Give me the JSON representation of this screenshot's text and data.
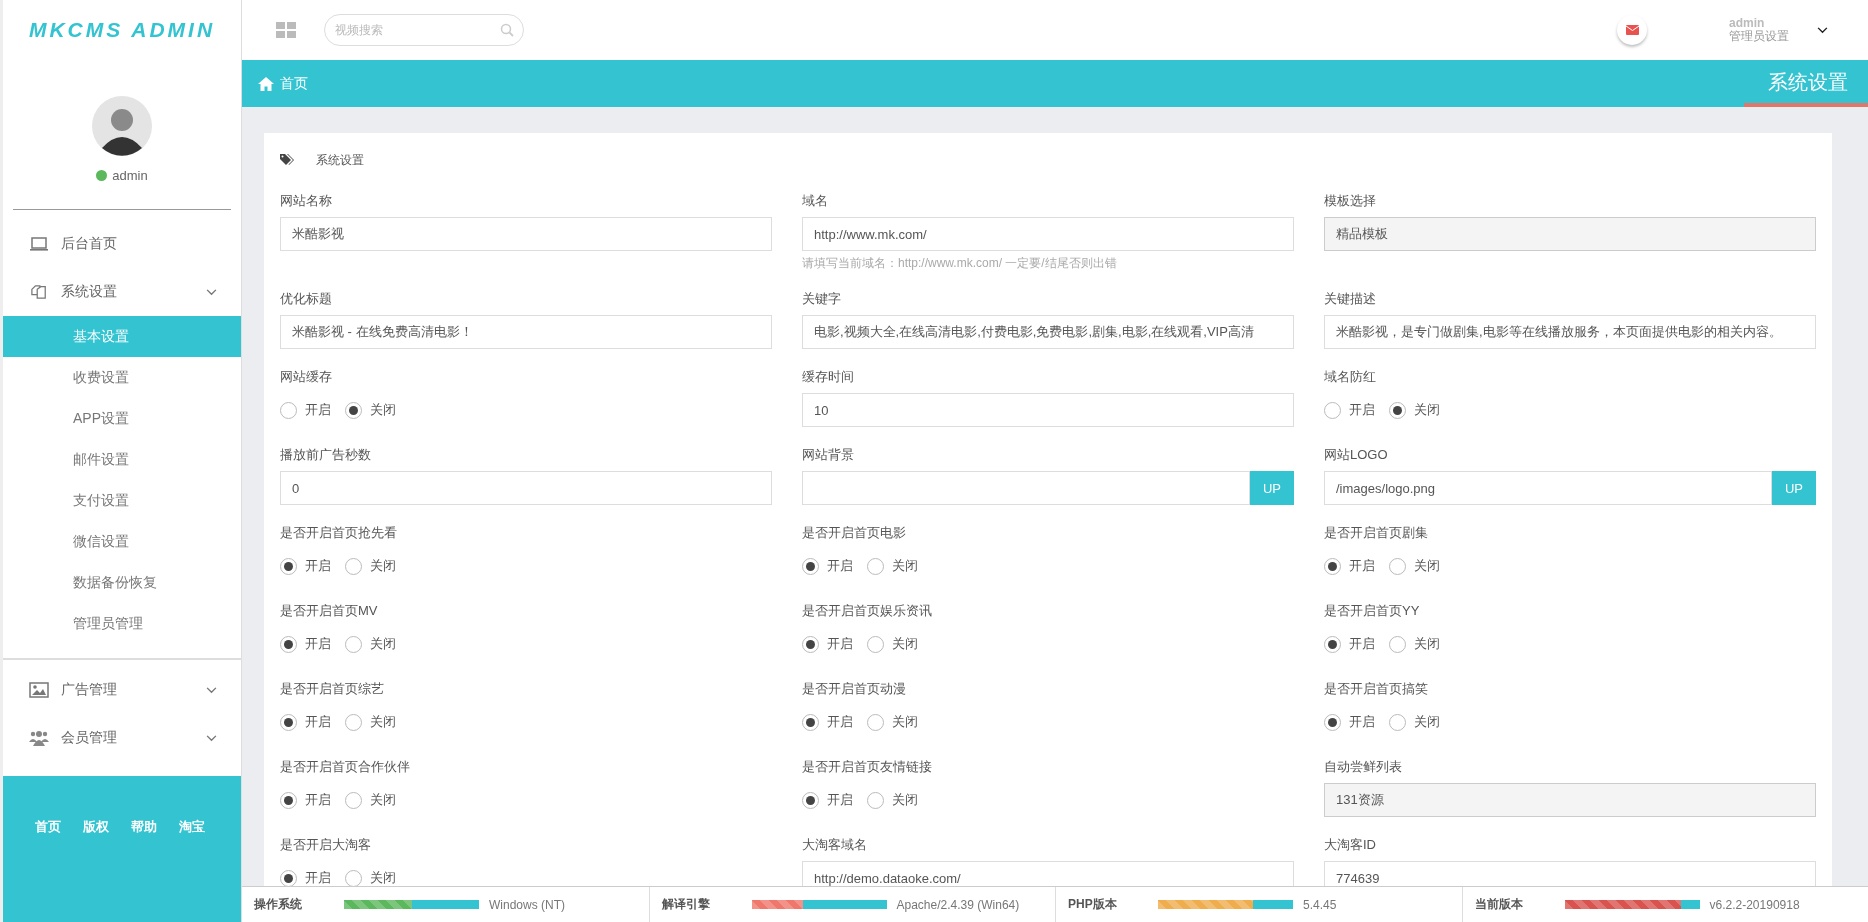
{
  "sidebar": {
    "logo": "MKCMS ADMIN",
    "user": {
      "name": "admin",
      "online": true
    },
    "nav": [
      {
        "label": "后台首页"
      },
      {
        "label": "系统设置",
        "children": [
          {
            "label": "基本设置",
            "selected": true
          },
          {
            "label": "收费设置",
            "selected": false
          },
          {
            "label": "APP设置",
            "selected": false
          },
          {
            "label": "邮件设置",
            "selected": false
          },
          {
            "label": "支付设置",
            "selected": false
          },
          {
            "label": "微信设置",
            "selected": false
          },
          {
            "label": "数据备份恢复",
            "selected": false
          },
          {
            "label": "管理员管理",
            "selected": false
          }
        ]
      },
      {
        "label": "广告管理"
      },
      {
        "label": "会员管理"
      }
    ],
    "footer_links": [
      "首页",
      "版权",
      "帮助",
      "淘宝"
    ]
  },
  "topbar": {
    "search": {
      "placeholder": "视频搜索"
    },
    "user": {
      "name": "admin",
      "role": "管理员设置"
    }
  },
  "breadcrumb": {
    "home": "首页",
    "title": "系统设置"
  },
  "form": {
    "title": "系统设置",
    "fields": [
      {
        "kind": "input",
        "label": "网站名称",
        "value": "米酷影视",
        "disabled": false
      },
      {
        "kind": "input",
        "label": "域名",
        "value": "http://www.mk.com/",
        "disabled": false,
        "hint": "请填写当前域名：http://www.mk.com/ 一定要/结尾否则出错"
      },
      {
        "kind": "input",
        "label": "模板选择",
        "value": "精品模板",
        "disabled": true
      },
      {
        "kind": "input",
        "label": "优化标题",
        "value": "米酷影视 - 在线免费高清电影！",
        "disabled": false
      },
      {
        "kind": "input",
        "label": "关键字",
        "value": "电影,视频大全,在线高清电影,付费电影,免费电影,剧集,电影,在线观看,VIP高清",
        "disabled": false
      },
      {
        "kind": "input",
        "label": "关键描述",
        "value": "米酷影视，是专门做剧集,电影等在线播放服务，本页面提供电影的相关内容。",
        "disabled": false
      },
      {
        "kind": "radio",
        "label": "网站缓存",
        "options": [
          {
            "label": "开启",
            "selected": false
          },
          {
            "label": "关闭",
            "selected": true
          }
        ]
      },
      {
        "kind": "input",
        "label": "缓存时间",
        "value": "10",
        "disabled": false
      },
      {
        "kind": "radio",
        "label": "域名防红",
        "options": [
          {
            "label": "开启",
            "selected": false
          },
          {
            "label": "关闭",
            "selected": true
          }
        ]
      },
      {
        "kind": "input",
        "label": "播放前广告秒数",
        "value": "0",
        "disabled": false
      },
      {
        "kind": "upload",
        "label": "网站背景",
        "button": "UP"
      },
      {
        "kind": "upload",
        "label": "网站LOGO",
        "value": "/images/logo.png",
        "button": "UP"
      },
      {
        "kind": "radio",
        "label": "是否开启首页抢先看",
        "options": [
          {
            "label": "开启",
            "selected": true
          },
          {
            "label": "关闭",
            "selected": false
          }
        ]
      },
      {
        "kind": "radio",
        "label": "是否开启首页电影",
        "options": [
          {
            "label": "开启",
            "selected": true
          },
          {
            "label": "关闭",
            "selected": false
          }
        ]
      },
      {
        "kind": "radio",
        "label": "是否开启首页剧集",
        "options": [
          {
            "label": "开启",
            "selected": true
          },
          {
            "label": "关闭",
            "selected": false
          }
        ]
      },
      {
        "kind": "radio",
        "label": "是否开启首页MV",
        "options": [
          {
            "label": "开启",
            "selected": true
          },
          {
            "label": "关闭",
            "selected": false
          }
        ]
      },
      {
        "kind": "radio",
        "label": "是否开启首页娱乐资讯",
        "options": [
          {
            "label": "开启",
            "selected": true
          },
          {
            "label": "关闭",
            "selected": false
          }
        ]
      },
      {
        "kind": "radio",
        "label": "是否开启首页YY",
        "options": [
          {
            "label": "开启",
            "selected": true
          },
          {
            "label": "关闭",
            "selected": false
          }
        ]
      },
      {
        "kind": "radio",
        "label": "是否开启首页综艺",
        "options": [
          {
            "label": "开启",
            "selected": true
          },
          {
            "label": "关闭",
            "selected": false
          }
        ]
      },
      {
        "kind": "radio",
        "label": "是否开启首页动漫",
        "options": [
          {
            "label": "开启",
            "selected": true
          },
          {
            "label": "关闭",
            "selected": false
          }
        ]
      },
      {
        "kind": "radio",
        "label": "是否开启首页搞笑",
        "options": [
          {
            "label": "开启",
            "selected": true
          },
          {
            "label": "关闭",
            "selected": false
          }
        ]
      },
      {
        "kind": "radio",
        "label": "是否开启首页合作伙伴",
        "options": [
          {
            "label": "开启",
            "selected": true
          },
          {
            "label": "关闭",
            "selected": false
          }
        ]
      },
      {
        "kind": "radio",
        "label": "是否开启首页友情链接",
        "options": [
          {
            "label": "开启",
            "selected": true
          },
          {
            "label": "关闭",
            "selected": false
          }
        ]
      },
      {
        "kind": "input",
        "label": "自动尝鲜列表",
        "value": "131资源",
        "disabled": true
      },
      {
        "kind": "radio",
        "label": "是否开启大淘客",
        "options": [
          {
            "label": "开启",
            "selected": true
          },
          {
            "label": "关闭",
            "selected": false
          }
        ]
      },
      {
        "kind": "input",
        "label": "大淘客域名",
        "value": "http://demo.dataoke.com/",
        "disabled": false
      },
      {
        "kind": "input",
        "label": "大淘客ID",
        "value": "774639",
        "disabled": false
      }
    ]
  },
  "status_bar": [
    {
      "label": "操作系统",
      "level": 0.5,
      "color": "#5cb85c",
      "value": "Windows (NT)"
    },
    {
      "label": "解译引擎",
      "level": 0.38,
      "color": "#f0776c",
      "value": "Apache/2.4.39 (Win64)"
    },
    {
      "label": "PHP版本",
      "level": 0.7,
      "color": "#f0ad4e",
      "value": "5.4.45"
    },
    {
      "label": "当前版本",
      "level": 0.86,
      "color": "#d9534f",
      "value": "v6.2.2-20190918"
    }
  ]
}
